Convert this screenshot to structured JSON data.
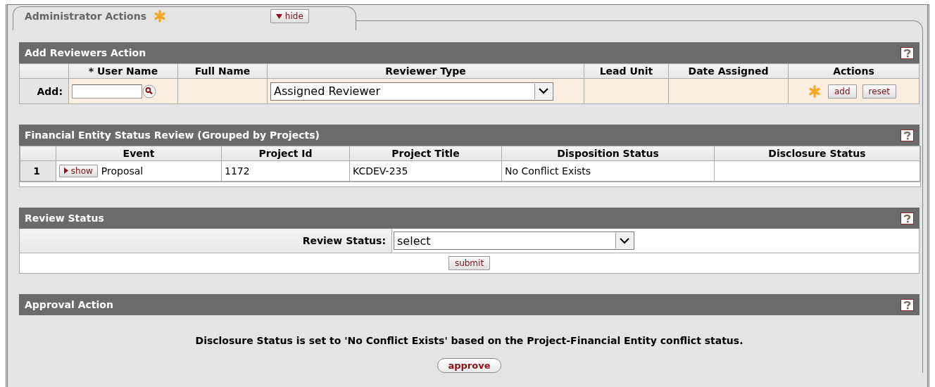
{
  "panel": {
    "title": "Administrator Actions",
    "toggle": "hide"
  },
  "add_reviewers": {
    "title": "Add Reviewers Action",
    "columns": [
      "* User Name",
      "Full Name",
      "Reviewer Type",
      "Lead Unit",
      "Date Assigned",
      "Actions"
    ],
    "row_label": "Add:",
    "reviewer_type": "Assigned Reviewer",
    "buttons": [
      "add",
      "reset"
    ]
  },
  "financial_entity_review": {
    "title": "Financial Entity Status Review (Grouped by Projects)",
    "columns": [
      "Event",
      "Project Id",
      "Project Title",
      "Disposition Status",
      "Disclosure Status"
    ],
    "rows": [
      {
        "index": "1",
        "toggle": "show",
        "event": "Proposal",
        "project_id": "1172",
        "project_title": "KCDEV-235",
        "disposition_status": "No Conflict Exists"
      }
    ]
  },
  "review_status": {
    "title": "Review Status",
    "label": "Review Status:",
    "value": "select",
    "button": "submit"
  },
  "approval_action": {
    "title": "Approval Action",
    "message": "Disclosure Status is set to 'No Conflict Exists' based on the Project-Financial Entity conflict status.",
    "button": "approve"
  }
}
